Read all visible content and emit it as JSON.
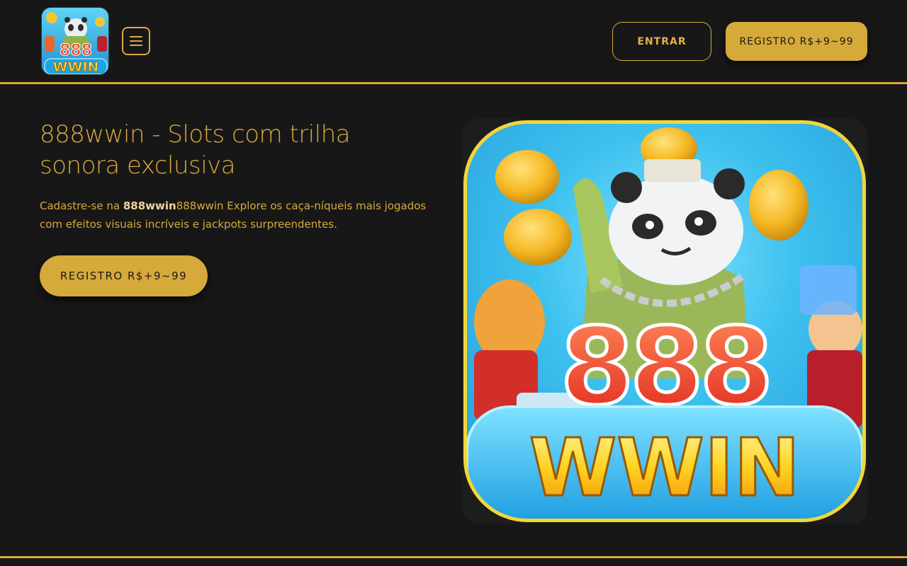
{
  "header": {
    "logo_text": {
      "top": "888",
      "bottom": "WWIN"
    },
    "menu_icon": "hamburger-icon",
    "login_label": "ENTRAR",
    "register_label": "REGISTRO R$+9~99"
  },
  "hero": {
    "title": "888wwin - Slots com trilha sonora exclusiva",
    "text_prefix": "Cadastre-se na ",
    "text_brand": "888wwin",
    "text_rest": "888wwin Explore os caça-níqueis mais jogados com efeitos visuais incríveis e jackpots surpreendentes.",
    "cta_label": "REGISTRO R$+9~99",
    "image_text": {
      "top": "888",
      "bottom": "WWIN"
    }
  },
  "colors": {
    "background": "#171718",
    "accent": "#d9aa3c",
    "button_fill": "#d6a93b"
  }
}
